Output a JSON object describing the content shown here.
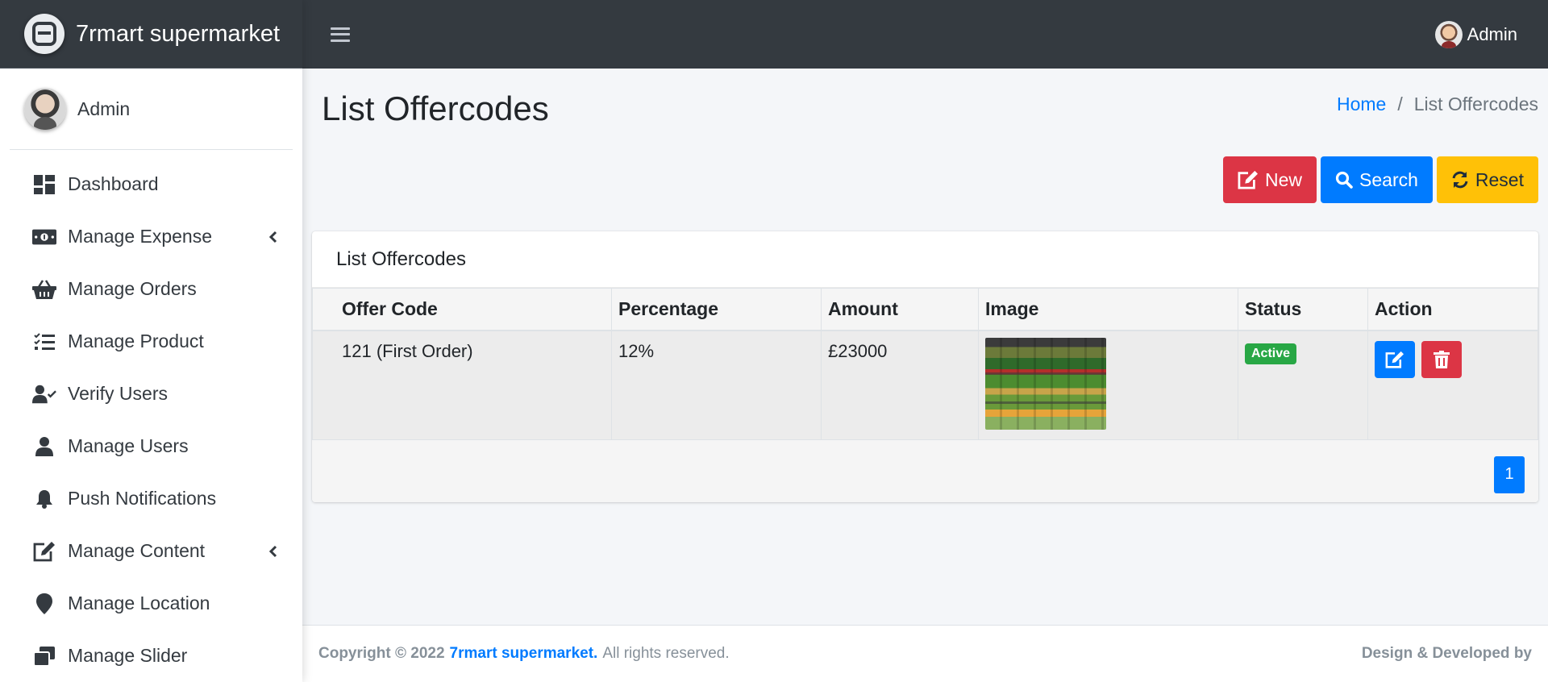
{
  "brand": {
    "name": "7rmart supermarket"
  },
  "sidebar": {
    "user_name": "Admin",
    "items": [
      {
        "label": "Dashboard",
        "icon": "dashboard-icon",
        "has_submenu": false
      },
      {
        "label": "Manage Expense",
        "icon": "money-bill-icon",
        "has_submenu": true
      },
      {
        "label": "Manage Orders",
        "icon": "basket-icon",
        "has_submenu": false
      },
      {
        "label": "Manage Product",
        "icon": "list-check-icon",
        "has_submenu": false
      },
      {
        "label": "Verify Users",
        "icon": "user-check-icon",
        "has_submenu": false
      },
      {
        "label": "Manage Users",
        "icon": "user-icon",
        "has_submenu": false
      },
      {
        "label": "Push Notifications",
        "icon": "bell-icon",
        "has_submenu": false
      },
      {
        "label": "Manage Content",
        "icon": "edit-icon",
        "has_submenu": true
      },
      {
        "label": "Manage Location",
        "icon": "map-marker-icon",
        "has_submenu": false
      },
      {
        "label": "Manage Slider",
        "icon": "window-restore-icon",
        "has_submenu": false
      }
    ]
  },
  "topbar": {
    "user_name": "Admin"
  },
  "page": {
    "title": "List Offercodes",
    "breadcrumb": {
      "home": "Home",
      "separator": "/",
      "current": "List Offercodes"
    }
  },
  "actions": {
    "new_label": "New",
    "search_label": "Search",
    "reset_label": "Reset"
  },
  "card": {
    "title": "List Offercodes",
    "columns": [
      "Offer Code",
      "Percentage",
      "Amount",
      "Image",
      "Status",
      "Action"
    ],
    "rows": [
      {
        "offer_code": "121 (First Order)",
        "percentage": "12%",
        "amount": "£23000",
        "status": "Active"
      }
    ],
    "pagination": {
      "current_page": "1"
    }
  },
  "footer": {
    "copyright": "Copyright © 2022",
    "brand": "7rmart supermarket.",
    "rights": "All rights reserved.",
    "right_text": "Design & Developed by"
  },
  "colors": {
    "sidebar_dark": "#343a40",
    "primary": "#007bff",
    "danger": "#dc3545",
    "warning": "#ffc107",
    "success": "#28a745"
  }
}
